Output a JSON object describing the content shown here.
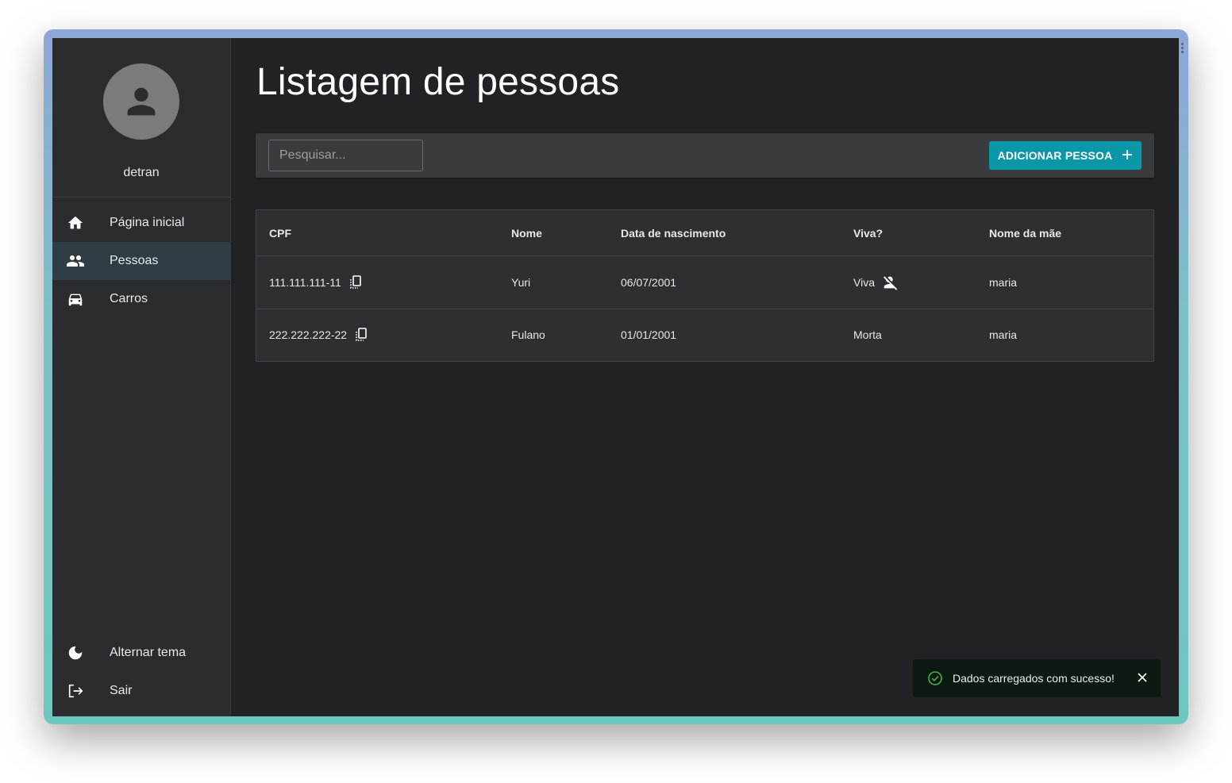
{
  "sidebar": {
    "username": "detran",
    "items": [
      {
        "label": "Página inicial",
        "icon": "home-icon"
      },
      {
        "label": "Pessoas",
        "icon": "people-icon",
        "active": true
      },
      {
        "label": "Carros",
        "icon": "car-icon"
      }
    ],
    "bottom_items": [
      {
        "label": "Alternar tema",
        "icon": "moon-icon"
      },
      {
        "label": "Sair",
        "icon": "logout-icon"
      }
    ]
  },
  "page": {
    "title": "Listagem de pessoas"
  },
  "toolbar": {
    "search_placeholder": "Pesquisar...",
    "search_value": "",
    "add_label": "ADICIONAR PESSOA"
  },
  "table": {
    "headers": [
      "CPF",
      "Nome",
      "Data de nascimento",
      "Viva?",
      "Nome da mãe"
    ],
    "rows": [
      {
        "cpf": "111.111.111-11",
        "nome": "Yuri",
        "nascimento": "06/07/2001",
        "viva": "Viva",
        "mae": "maria"
      },
      {
        "cpf": "222.222.222-22",
        "nome": "Fulano",
        "nascimento": "01/01/2001",
        "viva": "Morta",
        "mae": "maria"
      }
    ]
  },
  "toast": {
    "message": "Dados carregados com sucesso!",
    "status_color": "#4caf50"
  },
  "colors": {
    "accent": "#0a98a8",
    "background": "#212226",
    "sidebar": "#2b2c30"
  }
}
